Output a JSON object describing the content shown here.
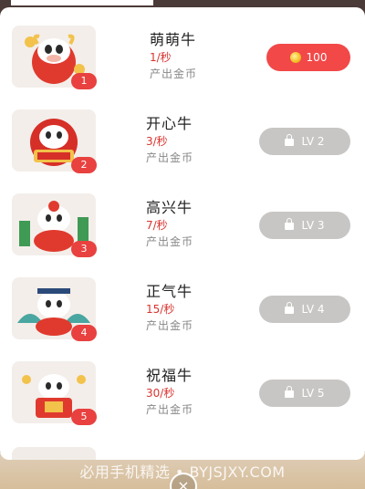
{
  "items": [
    {
      "name": "萌萌牛",
      "rate": "1/秒",
      "desc": "产出金币",
      "level": "1",
      "button": "100",
      "button_type": "buy"
    },
    {
      "name": "开心牛",
      "rate": "3/秒",
      "desc": "产出金币",
      "level": "2",
      "button": "LV 2",
      "button_type": "locked"
    },
    {
      "name": "高兴牛",
      "rate": "7/秒",
      "desc": "产出金币",
      "level": "3",
      "button": "LV 3",
      "button_type": "locked"
    },
    {
      "name": "正气牛",
      "rate": "15/秒",
      "desc": "产出金币",
      "level": "4",
      "button": "LV 4",
      "button_type": "locked"
    },
    {
      "name": "祝福牛",
      "rate": "30/秒",
      "desc": "产出金币",
      "level": "5",
      "button": "LV 5",
      "button_type": "locked"
    }
  ],
  "watermark": "必用手机精选 • BYJSJXY.COM",
  "close_label": "×",
  "colors": {
    "accent_red": "#f24848",
    "rate_red": "#d9342f",
    "locked_gray": "#c8c6c4"
  },
  "icons": {
    "coin": "coin-icon",
    "lock": "lock-icon",
    "close": "close-icon"
  }
}
